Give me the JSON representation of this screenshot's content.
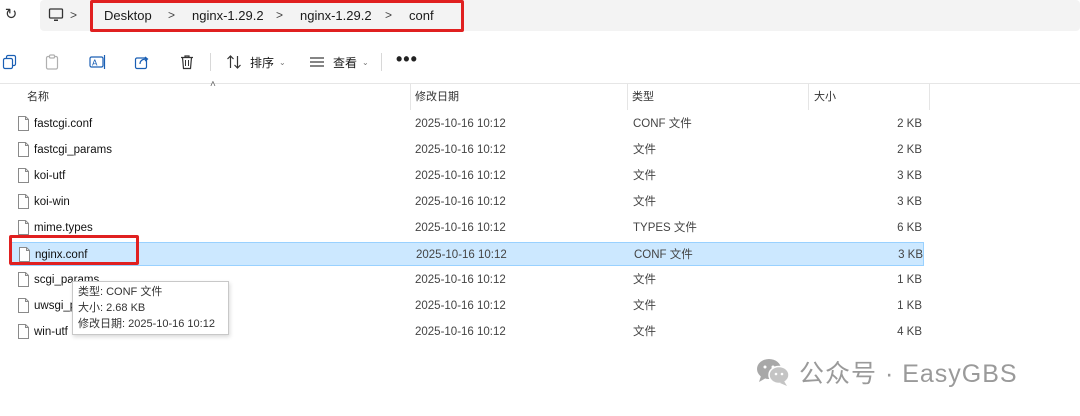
{
  "address_bar": {
    "breadcrumbs": [
      "Desktop",
      "nginx-1.29.2",
      "nginx-1.29.2",
      "conf"
    ],
    "separator": ">",
    "refresh_icon": "refresh-icon",
    "location_icon": "computer-icon"
  },
  "toolbar": {
    "icons": [
      "copy-icon",
      "paste-icon",
      "rename-icon",
      "share-icon",
      "delete-icon"
    ],
    "sort_label": "排序",
    "view_label": "查看",
    "more_label": "•••"
  },
  "columns": {
    "name": "名称",
    "date": "修改日期",
    "type": "类型",
    "size": "大小"
  },
  "files": [
    {
      "name": "fastcgi.conf",
      "date": "2025-10-16 10:12",
      "type": "CONF 文件",
      "size": "2 KB"
    },
    {
      "name": "fastcgi_params",
      "date": "2025-10-16 10:12",
      "type": "文件",
      "size": "2 KB"
    },
    {
      "name": "koi-utf",
      "date": "2025-10-16 10:12",
      "type": "文件",
      "size": "3 KB"
    },
    {
      "name": "koi-win",
      "date": "2025-10-16 10:12",
      "type": "文件",
      "size": "3 KB"
    },
    {
      "name": "mime.types",
      "date": "2025-10-16 10:12",
      "type": "TYPES 文件",
      "size": "6 KB"
    },
    {
      "name": "nginx.conf",
      "date": "2025-10-16 10:12",
      "type": "CONF 文件",
      "size": "3 KB"
    },
    {
      "name": "scgi_params",
      "date": "2025-10-16 10:12",
      "type": "文件",
      "size": "1 KB"
    },
    {
      "name": "uwsgi_params",
      "date": "2025-10-16 10:12",
      "type": "文件",
      "size": "1 KB"
    },
    {
      "name": "win-utf",
      "date": "2025-10-16 10:12",
      "type": "文件",
      "size": "4 KB"
    }
  ],
  "selected_file": "nginx.conf",
  "tooltip": {
    "type_line": "类型: CONF 文件",
    "size_line": "大小: 2.68 KB",
    "date_line": "修改日期: 2025-10-16 10:12"
  },
  "watermark": {
    "text": "公众号 · EasyGBS",
    "icon": "wechat-icon"
  },
  "colors": {
    "highlight_box": "#e02020",
    "selection_bg": "#cce8ff",
    "selection_border": "#99d1ff"
  }
}
